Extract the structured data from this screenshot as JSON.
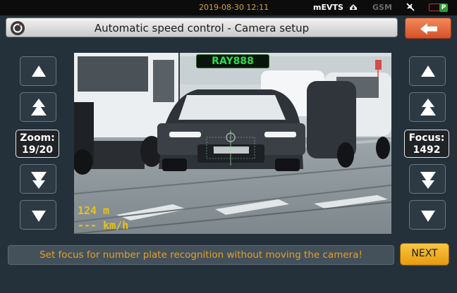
{
  "statusbar": {
    "datetime": "2019-08-30 12:11",
    "app_name": "mEVTS",
    "network": "GSM"
  },
  "header": {
    "title": "Automatic speed control - Camera setup"
  },
  "camera": {
    "plate_text": "RAY888",
    "distance": "124 m",
    "speed": "--- km/h"
  },
  "zoom": {
    "label": "Zoom:",
    "value": "19/20"
  },
  "focus": {
    "label": "Focus:",
    "value": "1492"
  },
  "footer": {
    "hint": "Set focus for number plate recognition without moving the camera!",
    "next_label": "NEXT"
  },
  "colors": {
    "accent_orange": "#e2a02c",
    "plate_green": "#27e04b",
    "overlay_yellow": "#e8c21a",
    "back_button": "#e06436"
  }
}
